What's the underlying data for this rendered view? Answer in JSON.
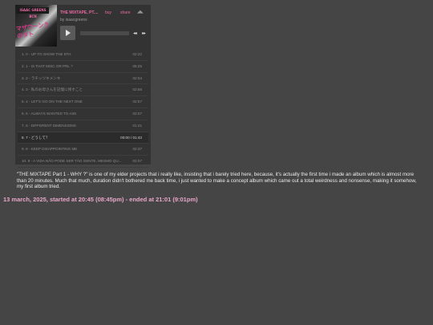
{
  "player": {
    "album_title": "THE MIXTAPE, PT....",
    "buy_label": "buy",
    "share_label": "share",
    "logo_text": "◢◣",
    "artist": "by isaacgreens",
    "cover_tag": "ISAAC GREENS BCN",
    "cover_scribble": "マザワーンうのタト",
    "play_icon": "play-icon",
    "prev_icon": "◂◂",
    "next_icon": "▸▸",
    "progress_percent": 0,
    "tracks": [
      {
        "num": "1.",
        "name": "0 - UP TO SHOW THE 5TH",
        "duration": "02:22"
      },
      {
        "num": "2.",
        "name": "1 - IS THAT MISC OR PRL ?",
        "duration": "05:25"
      },
      {
        "num": "3.",
        "name": "2 - ラチッツキメンキ",
        "duration": "02:04"
      },
      {
        "num": "4.",
        "name": "3 - 私のお母さんを記憶に残すこと",
        "duration": "02:56"
      },
      {
        "num": "5.",
        "name": "4 - LET'S GO ON THE NEXT ONE",
        "duration": "02:57"
      },
      {
        "num": "6.",
        "name": "5 - ALWAYS WANTED TO ASK",
        "duration": "02:07"
      },
      {
        "num": "7.",
        "name": "6 - DIFFERENT DIMENSIONS",
        "duration": "01:41"
      },
      {
        "num": "8.",
        "name": "7 - どうして？",
        "duration": "00:00 / 01:43",
        "current": true
      },
      {
        "num": "9.",
        "name": "8 - KEEP DISAPPOINTING ME",
        "duration": "02:37"
      },
      {
        "num": "10.",
        "name": "9 - A VIDA NÃO PODE SER TÃO GENTE, MESMO QU...",
        "duration": "02:07"
      }
    ]
  },
  "description": "\"THE MIXTAPE Part 1 - WHY ?\" is one of my elder projects that i really like, insisting that i barely tried here, because, it's actually the first time i made an album which is almost more than 20 minutes. Much that much, duration didn't bothered me back time, i just wanted to make a concept album which came out a total weirdness and nonsense, making it somehow, my first album tried.",
  "dates": "13 march, 2025, started at 20:45 (08:45pm) - ended at 21:01 (9:01pm)"
}
